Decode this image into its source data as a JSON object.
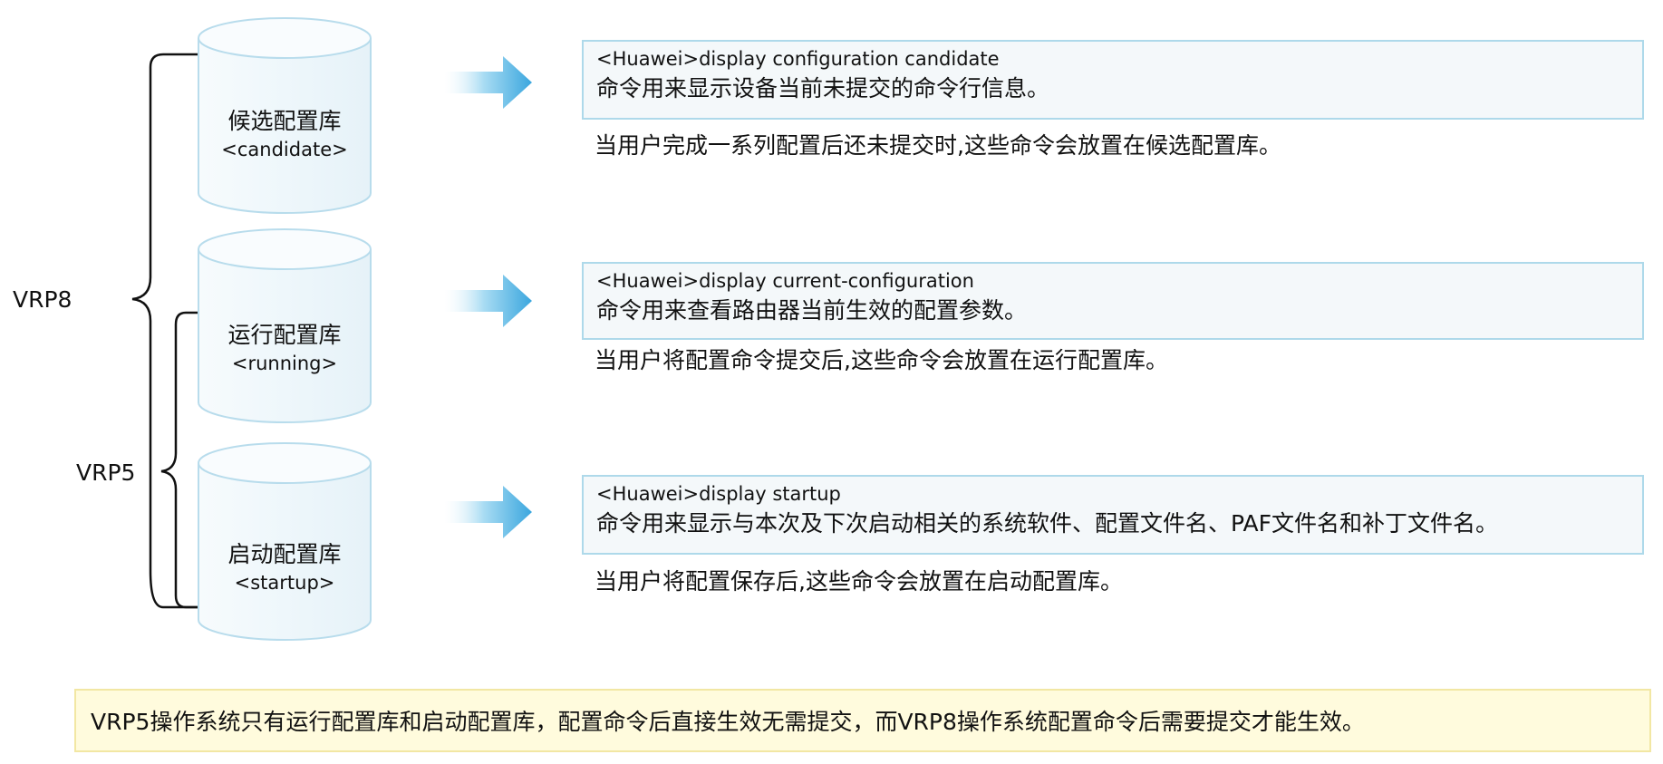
{
  "groups": {
    "vrp8_label": "VRP8",
    "vrp5_label": "VRP5"
  },
  "databases": [
    {
      "title": "候选配置库",
      "subtitle": "<candidate>"
    },
    {
      "title": "运行配置库",
      "subtitle": "<running>"
    },
    {
      "title": "启动配置库",
      "subtitle": "<startup>"
    }
  ],
  "commands": [
    {
      "command": "<Huawei>display configuration candidate",
      "description": "命令用来显示设备当前未提交的命令行信息。",
      "note": "当用户完成一系列配置后还未提交时,这些命令会放置在候选配置库。"
    },
    {
      "command": "<Huawei>display current-configuration",
      "description": "命令用来查看路由器当前生效的配置参数。",
      "note": "当用户将配置命令提交后,这些命令会放置在运行配置库。"
    },
    {
      "command": "<Huawei>display startup",
      "description": "命令用来显示与本次及下次启动相关的系统软件、配置文件名、PAF文件名和补丁文件名。",
      "note": "当用户将配置保存后,这些命令会放置在启动配置库。"
    }
  ],
  "footer": {
    "text": "VRP5操作系统只有运行配置库和启动配置库，配置命令后直接生效无需提交，而VRP8操作系统配置命令后需要提交才能生效。"
  },
  "colors": {
    "cylinder_fill": "#eef7fb",
    "cylinder_stroke": "#b8dcec",
    "arrow": "#4aaee0",
    "box_border": "#aed9ea",
    "box_fill": "#f4f8fa",
    "footer_fill": "#fffbdd",
    "footer_border": "#f2e7a3"
  }
}
